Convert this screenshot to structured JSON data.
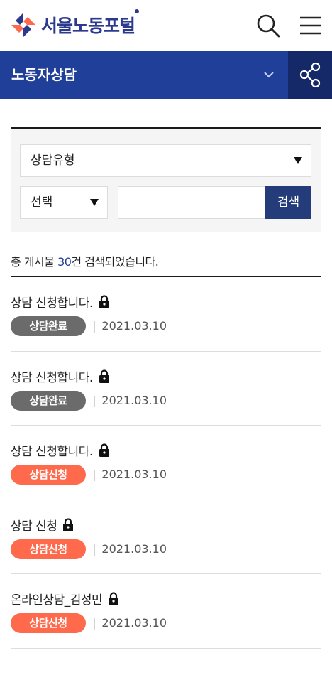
{
  "header": {
    "logo_text": "서울노동포털",
    "brand_color": "#2b3a8e",
    "icons": [
      "search-icon",
      "menu-icon"
    ]
  },
  "subnav": {
    "title": "노동자상담",
    "bg_color": "#1f3f99",
    "icons": [
      "chevron-down-icon",
      "share-icon"
    ]
  },
  "search": {
    "type_select": "상담유형",
    "field_select": "선택",
    "input_value": "",
    "input_placeholder": "",
    "button_label": "검색"
  },
  "results": {
    "prefix": "총 게시물 ",
    "count": "30",
    "suffix": "건 검색되었습니다."
  },
  "status_colors": {
    "상담완료": "#6b6b6b",
    "상담신청": "#ff6a4d"
  },
  "items": [
    {
      "title": "상담 신청합니다.",
      "status": "상담완료",
      "status_key": "done",
      "date": "2021.03.10",
      "locked": true
    },
    {
      "title": "상담 신청합니다.",
      "status": "상담완료",
      "status_key": "done",
      "date": "2021.03.10",
      "locked": true
    },
    {
      "title": "상담 신청합니다.",
      "status": "상담신청",
      "status_key": "req",
      "date": "2021.03.10",
      "locked": true
    },
    {
      "title": "상담 신청",
      "status": "상담신청",
      "status_key": "req",
      "date": "2021.03.10",
      "locked": true
    },
    {
      "title": "온라인상담_김성민",
      "status": "상담신청",
      "status_key": "req",
      "date": "2021.03.10",
      "locked": true
    }
  ]
}
